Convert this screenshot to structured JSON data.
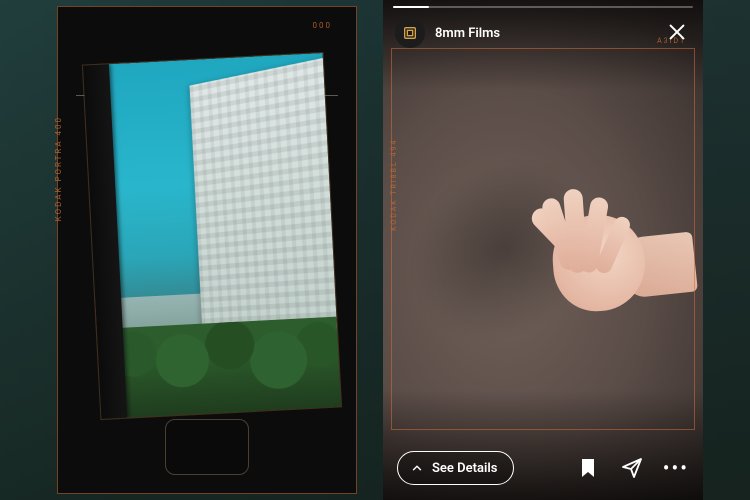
{
  "left_film": {
    "stock_label": "KODAK PORTRA 400",
    "frame_code": "000"
  },
  "right_story": {
    "username": "8mm Films",
    "film_stock_label": "KODAK TRI8BL 494",
    "film_code": "A3ID1",
    "see_details_label": "See Details",
    "more_label": "•••"
  }
}
